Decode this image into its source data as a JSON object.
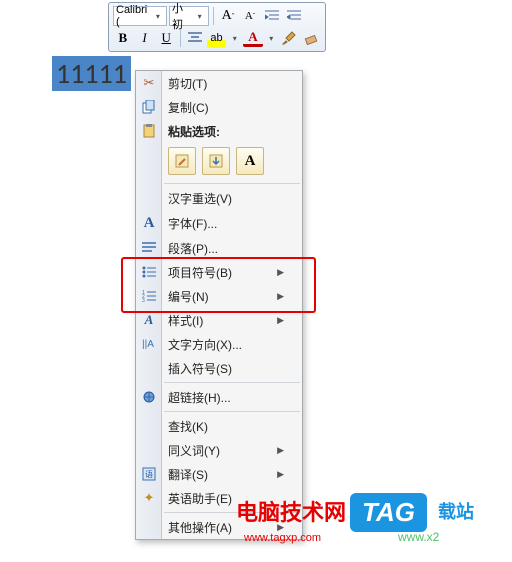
{
  "toolbar": {
    "font_name": "Calibri (",
    "font_size": "小初",
    "bold": "B",
    "italic": "I",
    "underline": "U",
    "grow": "A",
    "shrink": "A"
  },
  "document": {
    "selected_text": "11111"
  },
  "menu": {
    "cut": "剪切(T)",
    "copy": "复制(C)",
    "paste_options": "粘贴选项:",
    "paste_a": "A",
    "hanzi_reselect": "汉字重选(V)",
    "font": "字体(F)...",
    "paragraph": "段落(P)...",
    "bullets": "项目符号(B)",
    "numbering": "编号(N)",
    "styles": "样式(I)",
    "text_direction": "文字方向(X)...",
    "insert_symbol": "插入符号(S)",
    "hyperlink": "超链接(H)...",
    "lookup": "查找(K)",
    "synonyms": "同义词(Y)",
    "translate": "翻译(S)",
    "english_assistant": "英语助手(E)",
    "other_actions": "其他操作(A)"
  },
  "watermark": {
    "site_name": "电脑技术网",
    "site_url": "www.tagxp.com",
    "tag_label": "TAG",
    "dl_suffix": "载站",
    "dl_url": "www.x2"
  }
}
